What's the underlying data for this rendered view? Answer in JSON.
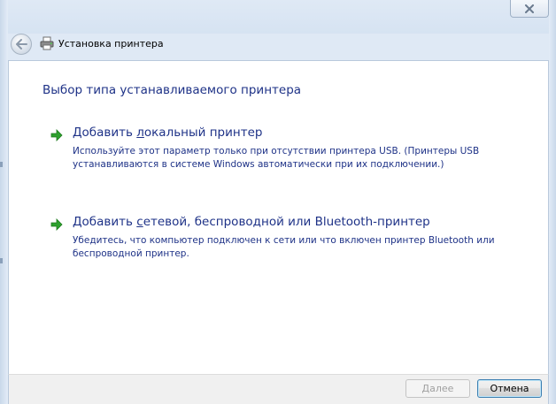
{
  "window": {
    "title": "Установка принтера"
  },
  "main": {
    "heading": "Выбор типа устанавливаемого принтера",
    "options": [
      {
        "title_before": "Добавить ",
        "title_accel": "л",
        "title_after": "окальный принтер",
        "description": "Используйте этот параметр только при отсутствии принтера USB. (Принтеры USB устанавливаются в системе Windows автоматически при их подключении.)"
      },
      {
        "title_before": "Добавить ",
        "title_accel": "с",
        "title_after": "етевой, беспроводной или Bluetooth-принтер",
        "description": "Убедитесь, что компьютер подключен к сети или что включен принтер Bluetooth или беспроводной принтер."
      }
    ]
  },
  "footer": {
    "next_label_accel": "Д",
    "next_label_rest": "алее",
    "cancel_label": "Отмена"
  },
  "colors": {
    "heading": "#1e3287",
    "arrow": "#2ea12e",
    "frame": "#dfe9f5"
  },
  "icons": {
    "close": "close-icon",
    "back": "back-arrow-icon",
    "printer": "printer-icon",
    "option_arrow": "green-arrow-icon"
  }
}
